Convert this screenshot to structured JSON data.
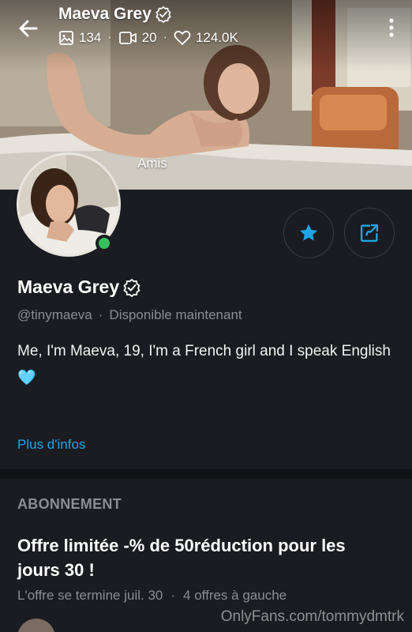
{
  "header": {
    "name": "Maeva Grey",
    "photos_count": "134",
    "videos_count": "20",
    "likes_count": "124.0K",
    "cover_caption": "Amis"
  },
  "profile": {
    "name": "Maeva Grey",
    "username": "@tinymaeva",
    "status": "Disponible maintenant",
    "bio": "Me, I'm Maeva, 19, I'm a French girl and I speak English🩵",
    "more_label": "Plus d'infos"
  },
  "subscription": {
    "section_title": "ABONNEMENT",
    "offer_title": "Offre limitée -% de 50réduction pour les jours 30 !",
    "offer_end": "L'offre se termine juil. 30",
    "offers_left": "4 offres à gauche"
  },
  "watermark": "OnlyFans.com/tommydmtrk",
  "colors": {
    "background": "#1b1c21",
    "accent": "#1ea4e6",
    "online": "#37c15c",
    "muted": "#8a8d96"
  },
  "icons": {
    "back": "arrow-left-icon",
    "menu": "more-vertical-icon",
    "photos": "image-icon",
    "videos": "video-icon",
    "likes": "heart-icon",
    "verified": "verified-badge-icon",
    "favorite": "star-icon",
    "share": "share-icon"
  }
}
